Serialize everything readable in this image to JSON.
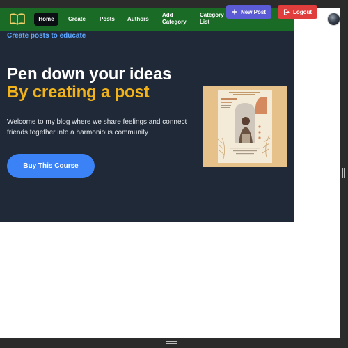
{
  "navbar": {
    "logo_icon": "open-book-icon",
    "items": [
      {
        "label": "Home"
      },
      {
        "label": "Create"
      },
      {
        "label": "Posts"
      },
      {
        "label": "Authors"
      },
      {
        "label": "Add Category"
      },
      {
        "label": "Category List"
      }
    ],
    "new_post": {
      "label": "New Post",
      "icon": "plus-icon"
    },
    "logout": {
      "label": "Logout",
      "icon": "logout-icon"
    },
    "avatar_icon": "avatar"
  },
  "hero": {
    "tagline": "Create posts to educate",
    "line1": "Pen down your ideas",
    "line2": "By creating a post",
    "description": "Welcome to my blog where we share feelings and connect friends together into a harmonious community",
    "cta": "Buy This Course",
    "image": "lifestyle-blog-mockup"
  },
  "colors": {
    "navbar": "#1a6b26",
    "hero_bg": "#1f2937",
    "accent_yellow": "#f2b31a",
    "tagline_blue": "#5fa8ff",
    "cta_blue": "#3b82f6",
    "new_post_purple": "#5b5bd6",
    "logout_red": "#e03d3d"
  }
}
